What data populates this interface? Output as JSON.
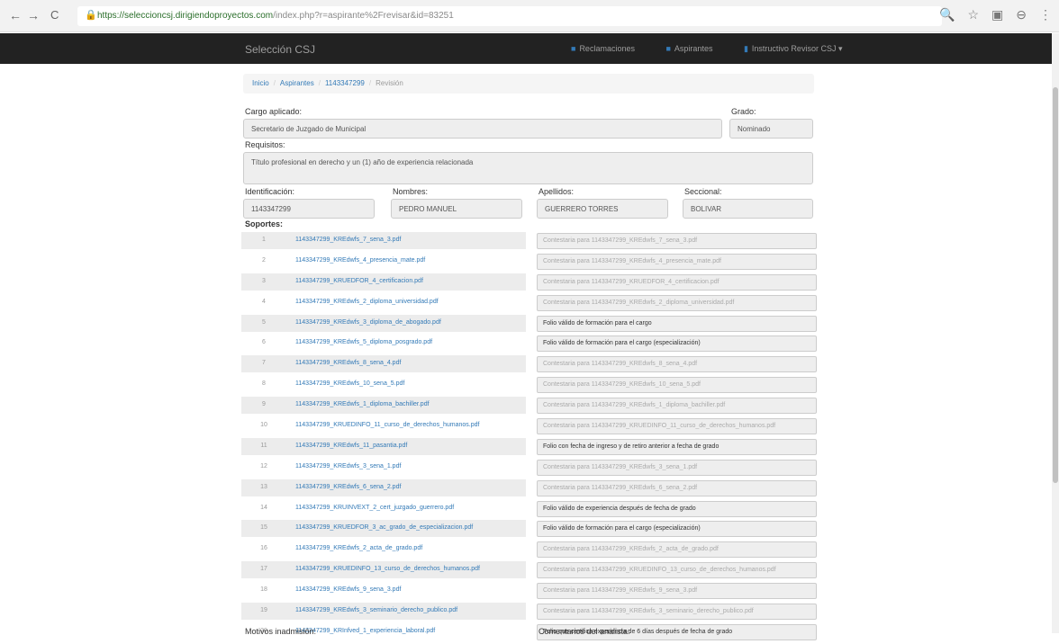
{
  "browser": {
    "back": "←",
    "forward": "→",
    "reload": "C",
    "url_host": "https://seleccioncsj.dirigiendoproyectos.com",
    "url_path": "/index.php?r=aspirante%2Frevisar&id=83251",
    "icons": [
      "zoom-icon",
      "star-icon",
      "extension-icon",
      "account-icon",
      "menu-icon"
    ]
  },
  "navbar": {
    "brand": "Selección CSJ",
    "links": [
      {
        "icon": "inbox-icon",
        "label": "Reclamaciones"
      },
      {
        "icon": "user-icon",
        "label": "Aspirantes"
      },
      {
        "icon": "person-icon",
        "label": "Instructivo Revisor CSJ ▾"
      }
    ]
  },
  "breadcrumb": {
    "items": [
      "Inicio",
      "Aspirantes",
      "1143347299",
      "Revisión"
    ]
  },
  "form": {
    "cargo_label": "Cargo aplicado:",
    "cargo_value": "Secretario de Juzgado de Municipal",
    "grado_label": "Grado:",
    "grado_value": "Nominado",
    "requisitos_label": "Requisitos:",
    "requisitos_value": "Título profesional en derecho y un (1) año de experiencia relacionada",
    "identificacion_label": "Identificación:",
    "identificacion_value": "1143347299",
    "nombres_label": "Nombres:",
    "nombres_value": "PEDRO MANUEL",
    "apellidos_label": "Apellidos:",
    "apellidos_value": "GUERRERO TORRES",
    "seccional_label": "Seccional:",
    "seccional_value": "BOLIVAR",
    "soportes_label": "Soportes:",
    "motivos_label": "Motivos inadmisión:",
    "comentarios_label": "Comentarios del analista:"
  },
  "soportes": [
    {
      "num": "1",
      "file": "1143347299_KREdwfs_7_sena_3.pdf",
      "comment": "Contestaria para 1143347299_KREdwfs_7_sena_3.pdf",
      "dark": false
    },
    {
      "num": "2",
      "file": "1143347299_KREdwfs_4_presencia_mate.pdf",
      "comment": "Contestaria para 1143347299_KREdwfs_4_presencia_mate.pdf",
      "dark": false
    },
    {
      "num": "3",
      "file": "1143347299_KRUEDFOR_4_certificacion.pdf",
      "comment": "Contestaria para 1143347299_KRUEDFOR_4_certificacion.pdf",
      "dark": false
    },
    {
      "num": "4",
      "file": "1143347299_KREdwfs_2_diploma_universidad.pdf",
      "comment": "Contestaria para 1143347299_KREdwfs_2_diploma_universidad.pdf",
      "dark": false
    },
    {
      "num": "5",
      "file": "1143347299_KREdwfs_3_diploma_de_abogado.pdf",
      "comment": "Folio válido de formación para el cargo",
      "dark": true
    },
    {
      "num": "6",
      "file": "1143347299_KREdwfs_5_diploma_posgrado.pdf",
      "comment": "Folio válido de formación para el cargo (especialización)",
      "dark": true
    },
    {
      "num": "7",
      "file": "1143347299_KREdwfs_8_sena_4.pdf",
      "comment": "Contestaria para 1143347299_KREdwfs_8_sena_4.pdf",
      "dark": false
    },
    {
      "num": "8",
      "file": "1143347299_KREdwfs_10_sena_5.pdf",
      "comment": "Contestaria para 1143347299_KREdwfs_10_sena_5.pdf",
      "dark": false
    },
    {
      "num": "9",
      "file": "1143347299_KREdwfs_1_diploma_bachiller.pdf",
      "comment": "Contestaria para 1143347299_KREdwfs_1_diploma_bachiller.pdf",
      "dark": false
    },
    {
      "num": "10",
      "file": "1143347299_KRUEDINFO_11_curso_de_derechos_humanos.pdf",
      "comment": "Contestaria para 1143347299_KRUEDINFO_11_curso_de_derechos_humanos.pdf",
      "dark": false
    },
    {
      "num": "11",
      "file": "1143347299_KREdwfs_11_pasantia.pdf",
      "comment": "Folio con fecha de ingreso y de retiro anterior a fecha de grado",
      "dark": true
    },
    {
      "num": "12",
      "file": "1143347299_KREdwfs_3_sena_1.pdf",
      "comment": "Contestaria para 1143347299_KREdwfs_3_sena_1.pdf",
      "dark": false
    },
    {
      "num": "13",
      "file": "1143347299_KREdwfs_6_sena_2.pdf",
      "comment": "Contestaria para 1143347299_KREdwfs_6_sena_2.pdf",
      "dark": false
    },
    {
      "num": "14",
      "file": "1143347299_KRUINVEXT_2_cert_juzgado_guerrero.pdf",
      "comment": "Folio válido de experiencia después de fecha de grado",
      "dark": true
    },
    {
      "num": "15",
      "file": "1143347299_KRUEDFOR_3_ac_grado_de_especializacion.pdf",
      "comment": "Folio válido de formación para el cargo (especialización)",
      "dark": true
    },
    {
      "num": "16",
      "file": "1143347299_KREdwfs_2_acta_de_grado.pdf",
      "comment": "Contestaria para 1143347299_KREdwfs_2_acta_de_grado.pdf",
      "dark": false
    },
    {
      "num": "17",
      "file": "1143347299_KRUEDINFO_13_curso_de_derechos_humanos.pdf",
      "comment": "Contestaria para 1143347299_KRUEDINFO_13_curso_de_derechos_humanos.pdf",
      "dark": false
    },
    {
      "num": "18",
      "file": "1143347299_KREdwfs_9_sena_3.pdf",
      "comment": "Contestaria para 1143347299_KREdwfs_9_sena_3.pdf",
      "dark": false
    },
    {
      "num": "19",
      "file": "1143347299_KREdwfs_3_seminario_derecho_publico.pdf",
      "comment": "Contestaria para 1143347299_KREdwfs_3_seminario_derecho_publico.pdf",
      "dark": false
    },
    {
      "num": "20",
      "file": "1143347299_KRInfved_1_experiencia_laboral.pdf",
      "comment": "Folio que certifica experiencia de 6 días después de fecha de grado",
      "dark": true
    }
  ]
}
